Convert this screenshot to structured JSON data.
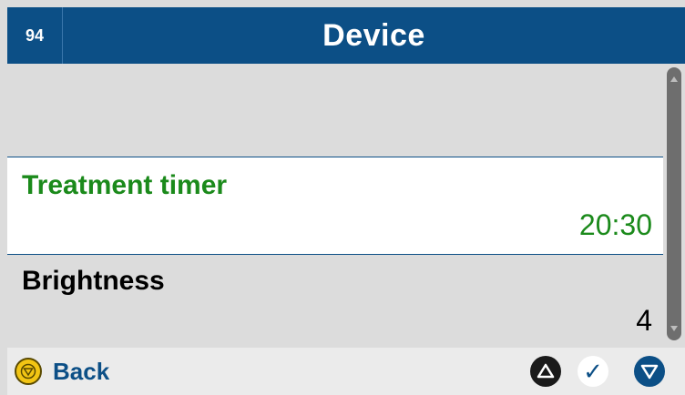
{
  "header": {
    "screen_number": "94",
    "title": "Device"
  },
  "list": {
    "items": [
      {
        "label": "Treatment timer",
        "value": "20:30",
        "selected": true
      },
      {
        "label": "Brightness",
        "value": "4",
        "selected": false
      }
    ]
  },
  "footer": {
    "back_label": "Back",
    "ok_symbol": "✓"
  },
  "icons": {
    "back": "back-circle-icon",
    "up": "triangle-up-icon",
    "ok": "checkmark-icon",
    "down": "triangle-down-icon"
  },
  "colors": {
    "header_bg": "#0c4f86",
    "selected_text": "#1b8a1b",
    "list_bg": "#dcdcdc",
    "back_button": "#f2c514"
  }
}
